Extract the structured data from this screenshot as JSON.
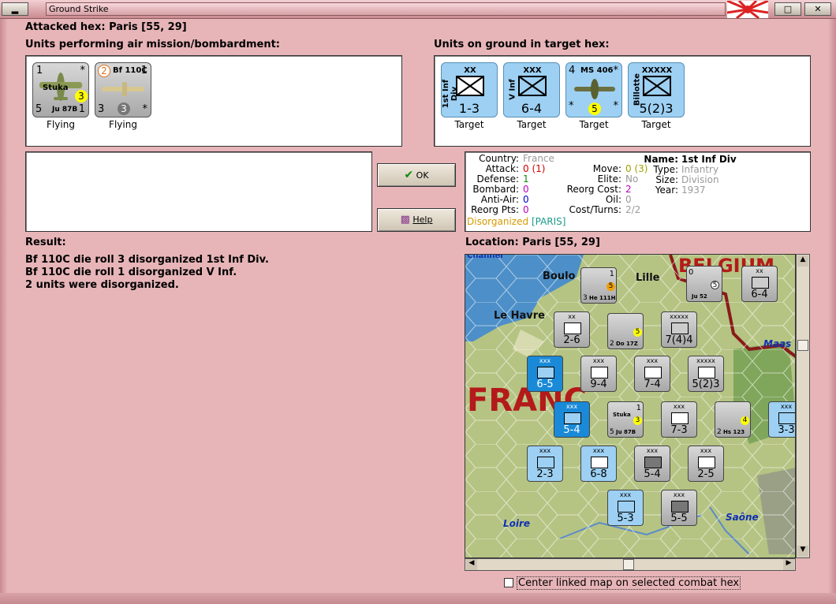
{
  "window": {
    "title": "Ground Strike"
  },
  "header": {
    "attacked_hex": "Attacked hex: Paris  [55, 29]"
  },
  "air_panel": {
    "label": "Units performing air mission/bombardment:",
    "units": [
      {
        "name": "Stuka",
        "top_left": "1",
        "type": "Ju 87B",
        "bottom_left": "5",
        "bottom_right": "1",
        "circle": "3",
        "star": "*",
        "caption": "Flying"
      },
      {
        "name": "Bf 110C",
        "top_left": "2",
        "bottom_left": "3",
        "bottom_right": "*",
        "circle": "3",
        "right": "1",
        "caption": "Flying"
      }
    ]
  },
  "ground_panel": {
    "label": "Units on ground in target hex:",
    "units": [
      {
        "side": "1st Inf Div",
        "size": "XX",
        "values": "1-3",
        "caption": "Target"
      },
      {
        "side": "V Inf",
        "size": "XXX",
        "values": "6-4",
        "caption": "Target"
      },
      {
        "name": "MS 406",
        "top_left": "4",
        "star": "*",
        "bottom_left": "*",
        "bottom_right": "*",
        "circle": "5",
        "caption": "Target"
      },
      {
        "side": "Billotte",
        "size": "XXXXX",
        "values": "5(2)3",
        "caption": "Target"
      }
    ]
  },
  "buttons": {
    "ok": "OK",
    "help": "Help"
  },
  "info": {
    "country_label": "Country:",
    "country": "France",
    "attack_label": "Attack:",
    "attack": "0",
    "attack_mod": "(1)",
    "defense_label": "Defense:",
    "defense": "1",
    "bombard_label": "Bombard:",
    "bombard": "0",
    "antiair_label": "Anti-Air:",
    "antiair": "0",
    "reorgpts_label": "Reorg Pts:",
    "reorgpts": "0",
    "move_label": "Move:",
    "move": "0",
    "move_mod": "(3)",
    "elite_label": "Elite:",
    "elite": "No",
    "reorgcost_label": "Reorg Cost:",
    "reorgcost": "2",
    "oil_label": "Oil:",
    "oil": "0",
    "costturns_label": "Cost/Turns:",
    "costturns": "2/2",
    "name_label": "Name:",
    "name": "1st Inf Div",
    "type_label": "Type:",
    "type": "Infantry",
    "size_label": "Size:",
    "size": "Division",
    "year_label": "Year:",
    "year": "1937",
    "status": "Disorganized",
    "status_loc": "[PARIS]"
  },
  "result": {
    "label": "Result:",
    "lines": [
      "Bf 110C die roll 3 disorganized 1st Inf Div.",
      "Bf 110C die roll 1 disorganized V Inf.",
      "2 units were disorganized."
    ]
  },
  "location": {
    "label": "Location:  Paris  [55, 29]"
  },
  "map": {
    "places": [
      "Boulo",
      "Lille",
      "Le Havre",
      "FRANC",
      "BELGIUM",
      "Maas",
      "Loire",
      "Saône",
      "Channel"
    ],
    "counters": [
      {
        "top": "xx",
        "val": "2-6"
      },
      {
        "top": "xxxxx",
        "val": "7(4)4"
      },
      {
        "top": "xxx",
        "val": "6-5"
      },
      {
        "top": "xxx",
        "val": "9-4"
      },
      {
        "top": "xxx",
        "val": "7-4"
      },
      {
        "top": "xxxxx",
        "val": "5(2)3"
      },
      {
        "top": "xxx",
        "val": "5-4"
      },
      {
        "top": "xxx",
        "val": "7-3"
      },
      {
        "top": "xxx",
        "val": "2-3"
      },
      {
        "top": "xxx",
        "val": "6-8"
      },
      {
        "top": "xxx",
        "val": "5-4"
      },
      {
        "top": "xxx",
        "val": "2-5"
      },
      {
        "top": "xxx",
        "val": "5-3"
      },
      {
        "top": "xxx",
        "val": "5-5"
      },
      {
        "top": "xx",
        "val": "6-4"
      },
      {
        "top": "xxx",
        "val": "3-3"
      }
    ],
    "air": [
      {
        "type": "He 111H",
        "left": "3",
        "right": "1",
        "circle": "5"
      },
      {
        "type": "Ju 52",
        "left": "0",
        "circle": "5"
      },
      {
        "type": "Do 17Z",
        "left": "2",
        "circle": "5"
      },
      {
        "type": "Ju 87B",
        "left": "5",
        "right": "1",
        "circle": "3",
        "name": "Stuka"
      },
      {
        "type": "Hs 123",
        "left": "2",
        "circle": "4"
      }
    ]
  },
  "footer": {
    "checkbox_label": "Center linked map on selected combat hex"
  },
  "colors": {
    "background": "#e7b5b8",
    "counter_blue": "#9dd0f3",
    "sea": "#4d8fc8"
  }
}
